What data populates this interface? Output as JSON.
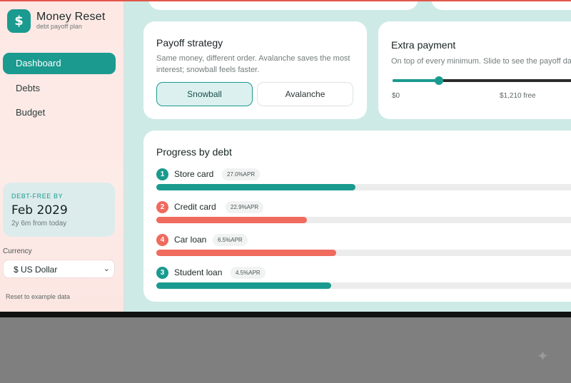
{
  "app": {
    "logo_symbol": "$",
    "title": "Money Reset",
    "subtitle": "debt payoff plan"
  },
  "nav": [
    {
      "label": "Dashboard",
      "active": true
    },
    {
      "label": "Debts",
      "active": false
    },
    {
      "label": "Budget",
      "active": false
    }
  ],
  "debt_free": {
    "label": "DEBT-FREE BY",
    "date": "Feb 2029",
    "sub": "2y 6m from today"
  },
  "currency": {
    "label": "Currency",
    "value": "$ US Dollar"
  },
  "reset_label": "Reset to example data",
  "strategy": {
    "title": "Payoff strategy",
    "description": "Same money, different order. Avalanche saves the most interest; snowball feels faster.",
    "options": [
      "Snowball",
      "Avalanche"
    ],
    "selected": "Snowball"
  },
  "extra": {
    "title": "Extra payment",
    "description": "On top of every minimum. Slide to see the payoff dat",
    "min_label": "$0",
    "free_label": "$1,210 free",
    "slider_fraction": 0.25
  },
  "progress": {
    "title": "Progress by debt",
    "debts": [
      {
        "order": "1",
        "name": "Store card",
        "apr": "27.0%APR",
        "progress": 0.45,
        "color": "#1b9a8f"
      },
      {
        "order": "2",
        "name": "Credit card",
        "apr": "22.9%APR",
        "progress": 0.34,
        "color": "#f06a5e"
      },
      {
        "order": "4",
        "name": "Car loan",
        "apr": "6.5%APR",
        "progress": 0.406,
        "color": "#f06a5e"
      },
      {
        "order": "3",
        "name": "Student loan",
        "apr": "4.5%APR",
        "progress": 0.395,
        "color": "#1b9a8f"
      }
    ]
  }
}
